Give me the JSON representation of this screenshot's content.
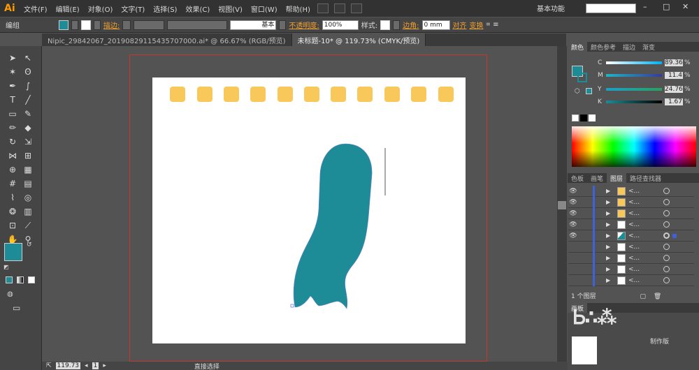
{
  "app": {
    "logo": "Ai"
  },
  "menu": [
    "文件(F)",
    "编辑(E)",
    "对象(O)",
    "文字(T)",
    "选择(S)",
    "效果(C)",
    "视图(V)",
    "窗口(W)",
    "帮助(H)"
  ],
  "workspace": {
    "label": "基本功能",
    "search_placeholder": ""
  },
  "control_bar": {
    "selection_label": "编组",
    "stroke_label": "描边:",
    "stroke_style": "基本",
    "opacity_label": "不透明度:",
    "opacity_value": "100%",
    "style_label": "样式:",
    "corner_label": "边角:",
    "corner_value": "0 mm",
    "align_label": "对齐",
    "transform_label": "变换",
    "fill_color": "#1e8c96"
  },
  "tabs": [
    {
      "label": "Nipic_29842067_20190829115435707000.ai* @ 66.67% (RGB/预览)"
    },
    {
      "label": "未标题-10* @ 119.73% (CMYK/预览)"
    }
  ],
  "color_panel": {
    "tabs": [
      "颜色",
      "颜色参考",
      "描边",
      "渐变"
    ],
    "c_label": "C",
    "c_value": "89.36",
    "m_label": "M",
    "m_value": "11.4",
    "y_label": "Y",
    "y_value": "24.76",
    "k_label": "K",
    "k_value": "1.67",
    "pct": "%",
    "swatch_color": "#1e8c96"
  },
  "layers_panel": {
    "tabs": [
      "色板",
      "画笔",
      "图层",
      "路径查找器"
    ],
    "rows": [
      {
        "name": "<...",
        "thumb": "#f8c85a"
      },
      {
        "name": "<...",
        "thumb": "#f8c85a"
      },
      {
        "name": "<...",
        "thumb": "#f8c85a"
      },
      {
        "name": "<...",
        "thumb": "#ffffff"
      },
      {
        "name": "<...",
        "thumb": "#1e8c96"
      },
      {
        "name": "<...",
        "thumb": "#ffffff"
      },
      {
        "name": "<...",
        "thumb": "#ffffff"
      },
      {
        "name": "<...",
        "thumb": "#ffffff"
      },
      {
        "name": "<...",
        "thumb": "#ffffff"
      }
    ],
    "footer": "1 个图层"
  },
  "artboards_panel": {
    "label": "画板",
    "badge": "制作版"
  },
  "status": {
    "zoom": "119.73",
    "page": "1",
    "tool": "直接选择"
  },
  "colors": {
    "accent": "#1e8c96",
    "yellow": "#f8c85a",
    "bleed": "#c0392b"
  }
}
